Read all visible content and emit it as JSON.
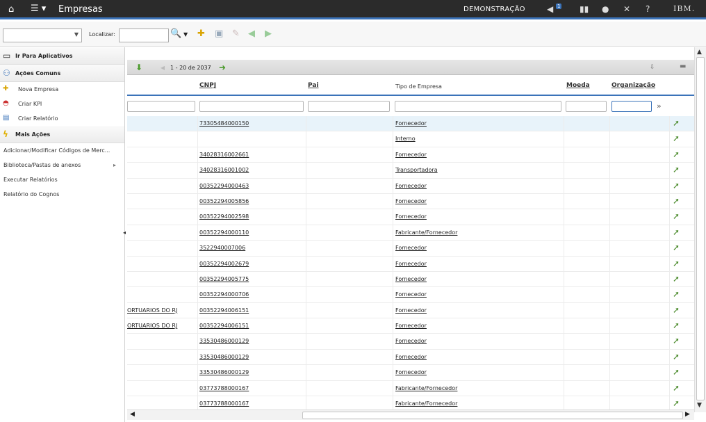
{
  "topbar": {
    "home_icon": "home-icon",
    "menu_icon": "menu-icon",
    "title": "Empresas",
    "demo_label": "DEMONSTRAÇÃO",
    "notifications_badge": "1",
    "brand": "IBM."
  },
  "toolbar": {
    "search_label": "Localizar:",
    "search_value": ""
  },
  "sidebar": {
    "goto_apps": "Ir Para Aplicativos",
    "common_actions": "Ações Comuns",
    "common_items": [
      {
        "label": "Nova Empresa",
        "icon": "new-record-icon"
      },
      {
        "label": "Criar KPI",
        "icon": "kpi-gauge-icon"
      },
      {
        "label": "Criar Relatório",
        "icon": "report-icon"
      }
    ],
    "more_actions": "Mais Ações",
    "more_items": [
      {
        "label": "Adicionar/Modificar Códigos de Merc..."
      },
      {
        "label": "Biblioteca/Pastas de anexos"
      },
      {
        "label": "Executar Relatórios"
      },
      {
        "label": "Relatório do Cognos"
      }
    ]
  },
  "grid": {
    "pager": "1 - 20 de 2037",
    "columns": {
      "cnpj": "CNPJ",
      "pai": "Pai",
      "tipo": "Tipo de Empresa",
      "moeda": "Moeda",
      "organizacao": "Organização"
    },
    "rows": [
      {
        "left": "",
        "cnpj": "73305484000150",
        "tipo": "Fornecedor"
      },
      {
        "left": "",
        "cnpj": "",
        "tipo": "Interno"
      },
      {
        "left": "",
        "cnpj": "34028316002661",
        "tipo": "Fornecedor"
      },
      {
        "left": "",
        "cnpj": "34028316001002",
        "tipo": "Transportadora"
      },
      {
        "left": "",
        "cnpj": "00352294000463",
        "tipo": "Fornecedor"
      },
      {
        "left": "",
        "cnpj": "00352294005856",
        "tipo": "Fornecedor"
      },
      {
        "left": "",
        "cnpj": "00352294002598",
        "tipo": "Fornecedor"
      },
      {
        "left": "",
        "cnpj": "00352294000110",
        "tipo": "Fabricante/Fornecedor"
      },
      {
        "left": "",
        "cnpj": "3522940007006",
        "tipo": "Fornecedor"
      },
      {
        "left": "",
        "cnpj": "00352294002679",
        "tipo": "Fornecedor"
      },
      {
        "left": "",
        "cnpj": "00352294005775",
        "tipo": "Fornecedor"
      },
      {
        "left": "",
        "cnpj": "00352294000706",
        "tipo": "Fornecedor"
      },
      {
        "left": "ORTUARIOS DO RJ",
        "cnpj": "00352294006151",
        "tipo": "Fornecedor"
      },
      {
        "left": "ORTUARIOS DO RJ",
        "cnpj": "00352294006151",
        "tipo": "Fornecedor"
      },
      {
        "left": "",
        "cnpj": "33530486000129",
        "tipo": "Fornecedor"
      },
      {
        "left": "",
        "cnpj": "33530486000129",
        "tipo": "Fornecedor"
      },
      {
        "left": "",
        "cnpj": "33530486000129",
        "tipo": "Fornecedor"
      },
      {
        "left": "",
        "cnpj": "03773788000167",
        "tipo": "Fabricante/Fornecedor"
      },
      {
        "left": "",
        "cnpj": "03773788000167",
        "tipo": "Fabricante/Fornecedor"
      }
    ]
  },
  "colors": {
    "accent": "#3b73b9",
    "topbar": "#2b2b2b",
    "selected_row": "#e8f3fa"
  }
}
